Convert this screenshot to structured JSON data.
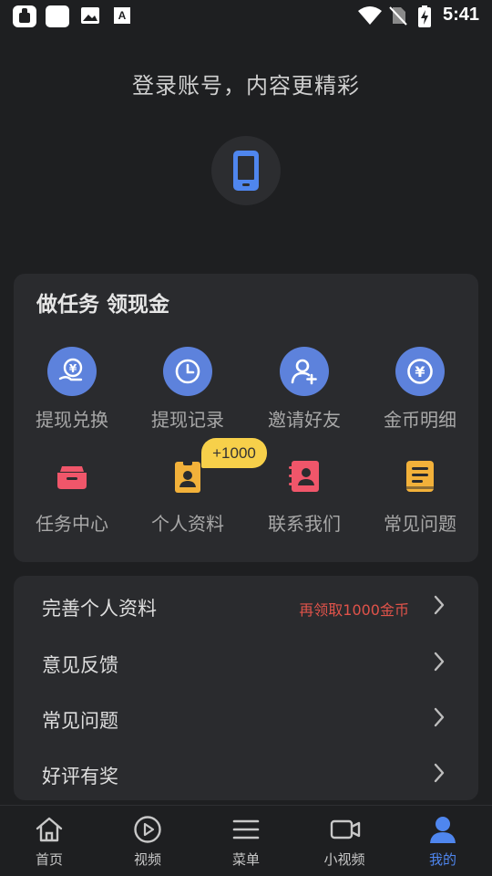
{
  "status_bar": {
    "time": "5:41",
    "left_icons": [
      "app-notification-icon",
      "blank-square-icon",
      "image-icon",
      "font-a-icon"
    ],
    "right_icons": [
      "wifi-icon",
      "no-sim-icon",
      "battery-charging-icon"
    ]
  },
  "header": {
    "login_prompt": "登录账号，内容更精彩",
    "avatar_icon": "phone-icon"
  },
  "task_card": {
    "title": "做任务 领现金",
    "items": [
      {
        "label": "提现兑换",
        "icon": "hand-yuan-icon",
        "color": "#5d82dc"
      },
      {
        "label": "提现记录",
        "icon": "clock-icon",
        "color": "#5d82dc"
      },
      {
        "label": "邀请好友",
        "icon": "add-user-icon",
        "color": "#5d82dc"
      },
      {
        "label": "金币明细",
        "icon": "yuan-coin-icon",
        "color": "#5d82dc"
      },
      {
        "label": "任务中心",
        "icon": "basket-icon",
        "color": "#f0566a"
      },
      {
        "label": "个人资料",
        "icon": "id-badge-icon",
        "color": "#f2b13a"
      },
      {
        "label": "联系我们",
        "icon": "contacts-book-icon",
        "color": "#f0566a"
      },
      {
        "label": "常见问题",
        "icon": "document-icon",
        "color": "#f2b13a"
      }
    ],
    "bonus_badge": "+1000"
  },
  "settings_list": {
    "rows": [
      {
        "label": "完善个人资料",
        "hint": "再领取1000金币"
      },
      {
        "label": "意见反馈",
        "hint": ""
      },
      {
        "label": "常见问题",
        "hint": ""
      },
      {
        "label": "好评有奖",
        "hint": ""
      }
    ]
  },
  "bottom_nav": {
    "items": [
      {
        "label": "首页",
        "icon": "home-icon"
      },
      {
        "label": "视频",
        "icon": "play-circle-icon"
      },
      {
        "label": "菜单",
        "icon": "menu-icon"
      },
      {
        "label": "小视频",
        "icon": "video-camera-icon"
      },
      {
        "label": "我的",
        "icon": "user-icon"
      }
    ],
    "active_index": 4,
    "active_color": "#4f86ee"
  }
}
